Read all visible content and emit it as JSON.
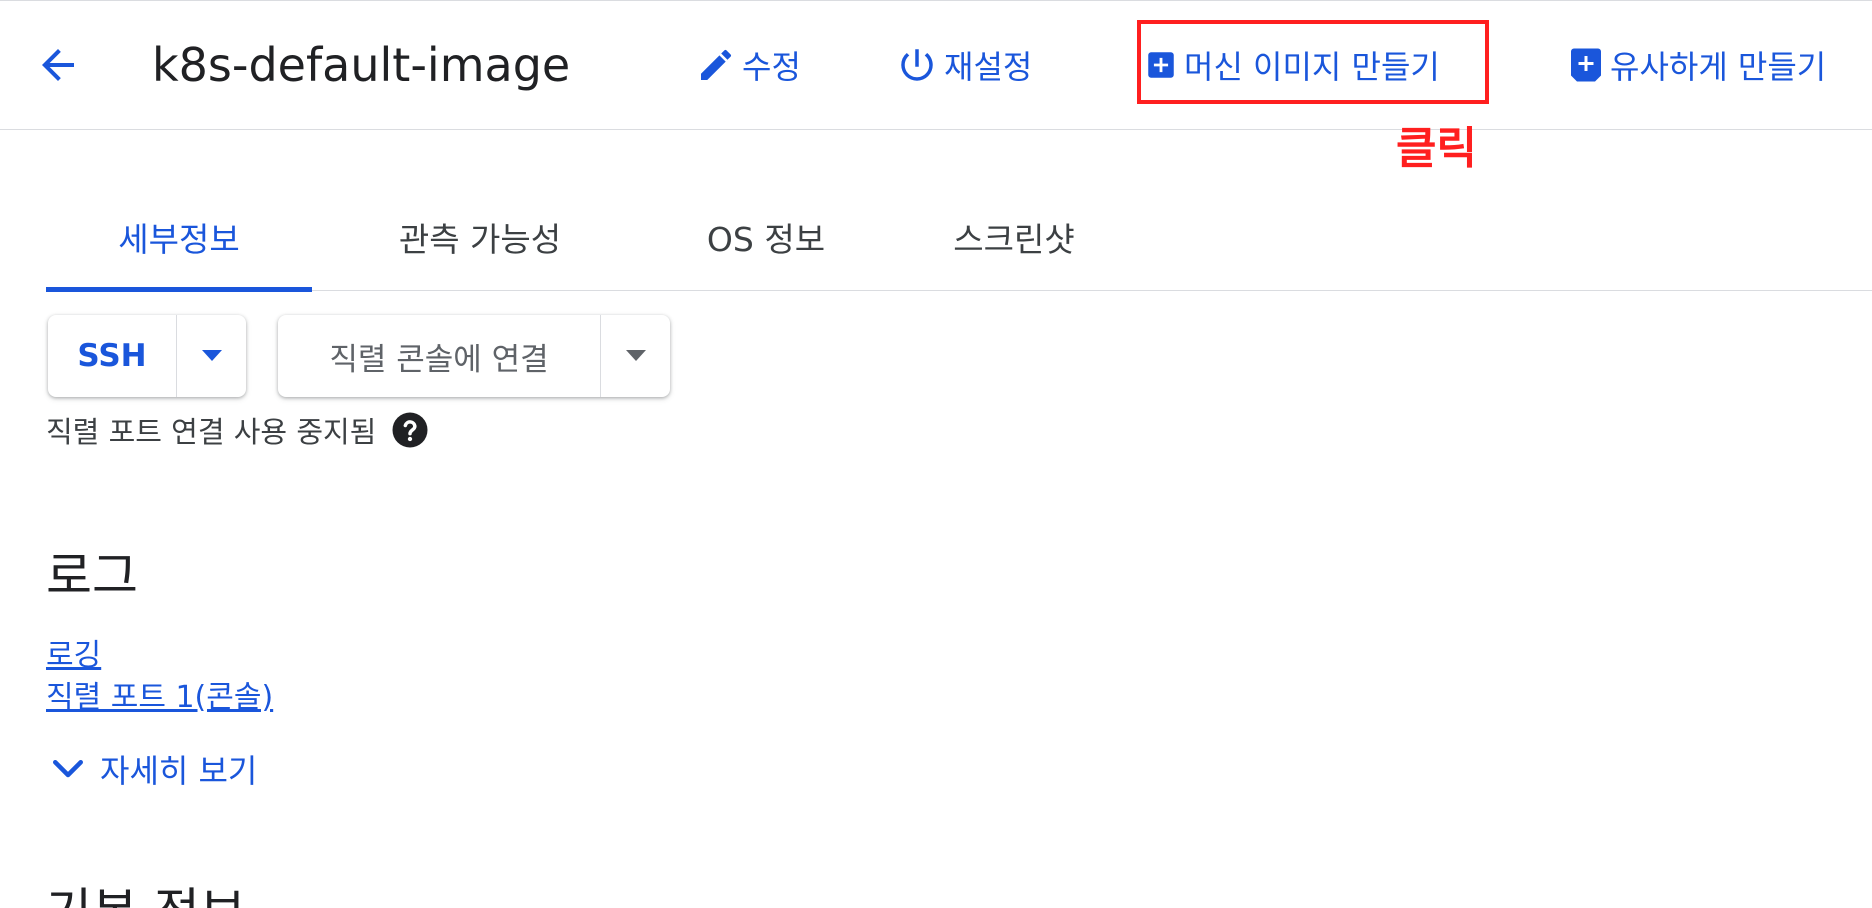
{
  "header": {
    "title": "k8s-default-image",
    "toolbar": {
      "edit_label": "수정",
      "reset_label": "재설정",
      "create_machine_image_label": "머신 이미지 만들기",
      "create_similar_label": "유사하게 만들기"
    }
  },
  "annotation": {
    "text": "클릭",
    "color": "#ff1f1f"
  },
  "tabs": [
    {
      "label": "세부정보",
      "active": true
    },
    {
      "label": "관측 가능성",
      "active": false
    },
    {
      "label": "OS 정보",
      "active": false
    },
    {
      "label": "스크린샷",
      "active": false
    }
  ],
  "connect": {
    "ssh_label": "SSH",
    "serial_label": "직렬 콘솔에 연결",
    "serial_note": "직렬 포트 연결 사용 중지됨"
  },
  "logs": {
    "title": "로그",
    "links": [
      "로깅",
      "직렬 포트 1(콘솔)"
    ],
    "show_more": "자세히 보기"
  },
  "basic_info": {
    "title": "기본 정보"
  },
  "colors": {
    "accent": "#1a56db",
    "highlight": "#ff1f1f"
  }
}
